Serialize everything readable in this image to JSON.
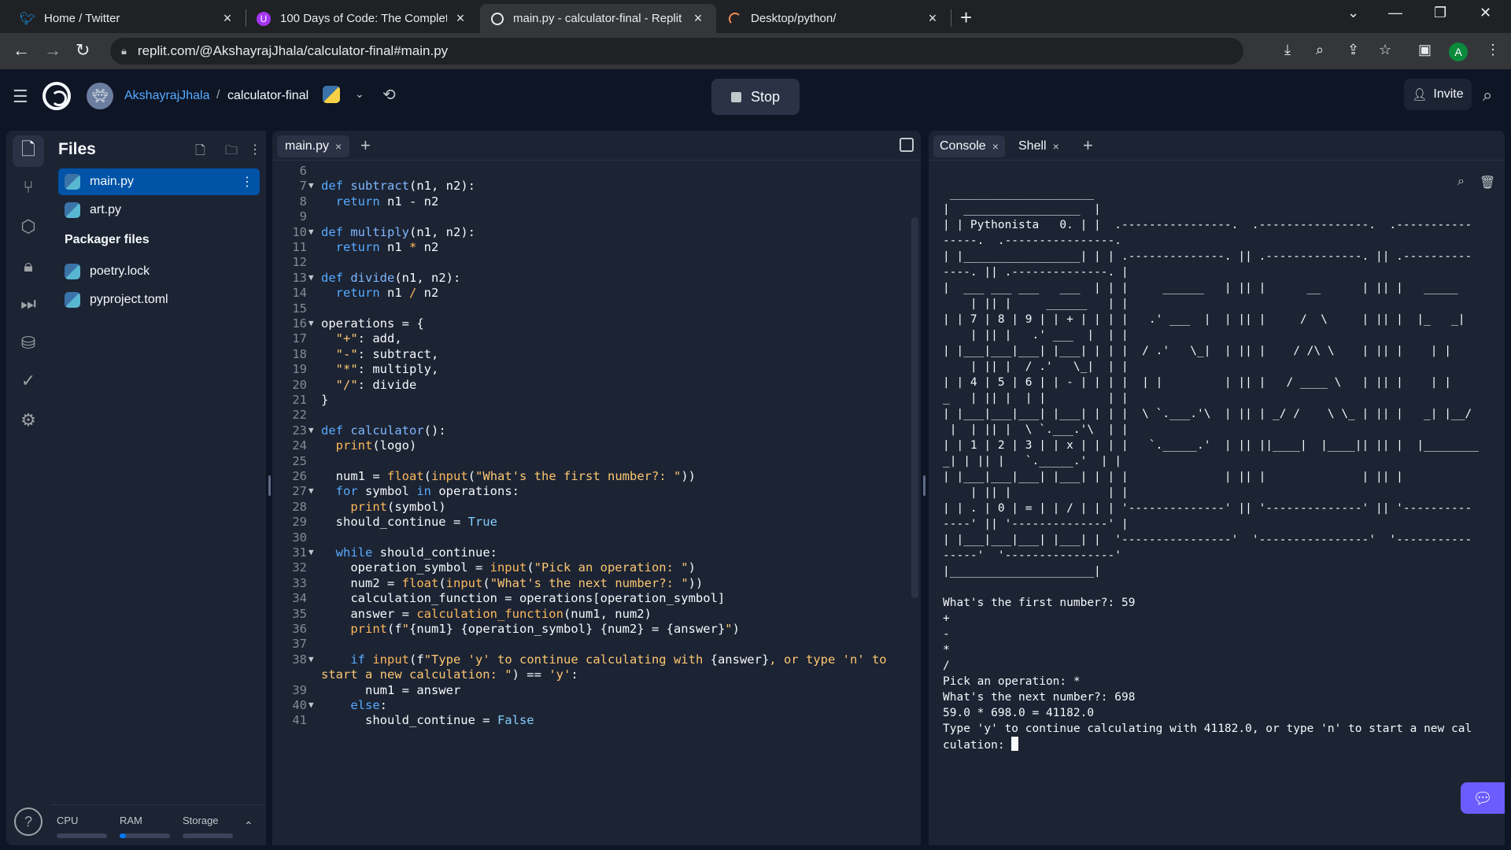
{
  "browser": {
    "tabs": [
      {
        "title": "Home / Twitter",
        "favicon": "twitter-bird-icon",
        "active": false
      },
      {
        "title": "100 Days of Code: The Complete",
        "favicon": "udemy-icon",
        "active": false
      },
      {
        "title": "main.py - calculator-final - Replit",
        "favicon": "replit-icon",
        "active": true
      },
      {
        "title": "Desktop/python/",
        "favicon": "loading-spinner-icon",
        "active": false
      }
    ],
    "url": "replit.com/@AkshayrajJhala/calculator-final#main.py",
    "profile_initial": "A"
  },
  "header": {
    "username": "AkshayrajJhala",
    "separator": "/",
    "repl_name": "calculator-final",
    "stop_label": "Stop",
    "invite_label": "Invite"
  },
  "files": {
    "title": "Files",
    "items": [
      {
        "name": "main.py",
        "active": true
      },
      {
        "name": "art.py",
        "active": false
      }
    ],
    "packager_heading": "Packager files",
    "packager_items": [
      {
        "name": "poetry.lock"
      },
      {
        "name": "pyproject.toml"
      }
    ],
    "resources": [
      {
        "label": "CPU",
        "usage": 0.0
      },
      {
        "label": "RAM",
        "usage": 0.12
      },
      {
        "label": "Storage",
        "usage": 0.0
      }
    ]
  },
  "editor": {
    "tab": "main.py",
    "lines": [
      {
        "n": "6",
        "fold": false,
        "html": ""
      },
      {
        "n": "7",
        "fold": true,
        "html": "<span class=\"kw\">def</span> <span class=\"fn\">subtract</span>(n1, n2):"
      },
      {
        "n": "8",
        "fold": false,
        "html": "  <span class=\"kw\">return</span> n1 - n2"
      },
      {
        "n": "9",
        "fold": false,
        "html": ""
      },
      {
        "n": "10",
        "fold": true,
        "html": "<span class=\"kw\">def</span> <span class=\"fn\">multiply</span>(n1, n2):"
      },
      {
        "n": "11",
        "fold": false,
        "html": "  <span class=\"kw\">return</span> n1 <span class=\"bi\">*</span> n2"
      },
      {
        "n": "12",
        "fold": false,
        "html": ""
      },
      {
        "n": "13",
        "fold": true,
        "html": "<span class=\"kw\">def</span> <span class=\"fn\">divide</span>(n1, n2):"
      },
      {
        "n": "14",
        "fold": false,
        "html": "  <span class=\"kw\">return</span> n1 <span class=\"bi\">/</span> n2"
      },
      {
        "n": "15",
        "fold": false,
        "html": ""
      },
      {
        "n": "16",
        "fold": true,
        "html": "operations = {"
      },
      {
        "n": "17",
        "fold": false,
        "html": "  <span class=\"str\">\"+\"</span>: add,"
      },
      {
        "n": "18",
        "fold": false,
        "html": "  <span class=\"str\">\"-\"</span>: subtract,"
      },
      {
        "n": "19",
        "fold": false,
        "html": "  <span class=\"str\">\"*\"</span>: multiply,"
      },
      {
        "n": "20",
        "fold": false,
        "html": "  <span class=\"str\">\"/\"</span>: divide"
      },
      {
        "n": "21",
        "fold": false,
        "html": "}"
      },
      {
        "n": "22",
        "fold": false,
        "html": ""
      },
      {
        "n": "23",
        "fold": true,
        "html": "<span class=\"kw\">def</span> <span class=\"fn\">calculator</span>():"
      },
      {
        "n": "24",
        "fold": false,
        "html": "  <span class=\"bi\">print</span>(logo)"
      },
      {
        "n": "25",
        "fold": false,
        "html": ""
      },
      {
        "n": "26",
        "fold": false,
        "html": "  num1 = <span class=\"bi\">float</span>(<span class=\"bi\">input</span>(<span class=\"str\">\"What's the first number?: \"</span>))"
      },
      {
        "n": "27",
        "fold": true,
        "html": "  <span class=\"kw\">for</span> symbol <span class=\"kw\">in</span> operations:"
      },
      {
        "n": "28",
        "fold": false,
        "html": "    <span class=\"bi\">print</span>(symbol)"
      },
      {
        "n": "29",
        "fold": false,
        "html": "  should_continue = <span class=\"cst\">True</span>"
      },
      {
        "n": "30",
        "fold": false,
        "html": ""
      },
      {
        "n": "31",
        "fold": true,
        "html": "  <span class=\"kw\">while</span> should_continue:"
      },
      {
        "n": "32",
        "fold": false,
        "html": "    operation_symbol = <span class=\"bi\">input</span>(<span class=\"str\">\"Pick an operation: \"</span>)"
      },
      {
        "n": "33",
        "fold": false,
        "html": "    num2 = <span class=\"bi\">float</span>(<span class=\"bi\">input</span>(<span class=\"str\">\"What's the next number?: \"</span>))"
      },
      {
        "n": "34",
        "fold": false,
        "html": "    calculation_function = operations[operation_symbol]"
      },
      {
        "n": "35",
        "fold": false,
        "html": "    answer = <span class=\"bi\">calculation_function</span>(num1, num2)"
      },
      {
        "n": "36",
        "fold": false,
        "html": "    <span class=\"bi\">print</span>(f<span class=\"str\">\"</span>{num1} {operation_symbol} {num2} = {answer}<span class=\"str\">\"</span>)"
      },
      {
        "n": "37",
        "fold": false,
        "html": ""
      },
      {
        "n": "38",
        "fold": true,
        "html": "    <span class=\"kw\">if</span> <span class=\"bi\">input</span>(f<span class=\"str\">\"Type 'y' to continue calculating with </span>{answer}<span class=\"str\">, or type 'n' to</span>"
      },
      {
        "n": "",
        "fold": false,
        "html": "<span class=\"str\">start a new calculation: \"</span>) == <span class=\"str\">'y'</span>:"
      },
      {
        "n": "39",
        "fold": false,
        "html": "      num1 = answer"
      },
      {
        "n": "40",
        "fold": true,
        "html": "    <span class=\"kw\">else</span>:"
      },
      {
        "n": "41",
        "fold": false,
        "html": "      should_continue = <span class=\"cst\">False</span>"
      }
    ]
  },
  "console": {
    "tabs": [
      "Console",
      "Shell"
    ],
    "output": " _____________________\n|  _________________  |\n| | Pythonista   0. | |  .----------------.  .----------------.  .-----------\n-----.  .----------------.\n| |_________________| | | .--------------. || .--------------. || .----------\n----. || .--------------. |\n|  ___ ___ ___   ___  | | |     ______   | || |      __      | || |   _____\n    | || |     ______   | |\n| | 7 | 8 | 9 | | + | | | |   .' ___  |  | || |     /  \\     | || |  |_   _|\n    | || |   .' ___  |  | |\n| |___|___|___| |___| | | |  / .'   \\_|  | || |    / /\\ \\    | || |    | |\n    | || |  / .'   \\_|  | |\n| | 4 | 5 | 6 | | - | | | |  | |         | || |   / ____ \\   | || |    | |\n_   | || |  | |         | |\n| |___|___|___| |___| | | |  \\ `.___.'\\  | || | _/ /    \\ \\_ | || |   _| |__/\n |  | || |  \\ `.___.'\\  | |\n| | 1 | 2 | 3 | | x | | | |   `._____.'  | || ||____|  |____|| || |  |________\n_| | || |   `._____.'  | |\n| |___|___|___| |___| | | |              | || |              | || |\n    | || |              | |\n| | . | 0 | = | | / | | | '--------------' || '--------------' || '----------\n----' || '--------------' |\n| |___|___|___| |___| |  '----------------'  '----------------'  '-----------\n-----'  '----------------'\n|_____________________|\n\nWhat's the first number?: 59\n+\n-\n*\n/\nPick an operation: *\nWhat's the next number?: 698\n59.0 * 698.0 = 41182.0\nType 'y' to continue calculating with 41182.0, or type 'n' to start a new cal\nculation: "
  },
  "colors": {
    "background": "#0e1525",
    "panel": "#1c2333",
    "accent": "#0079f2",
    "active_file": "#0053a6"
  }
}
